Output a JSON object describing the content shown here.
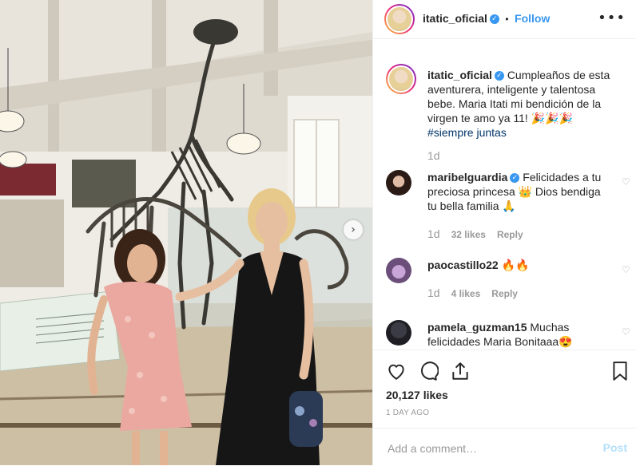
{
  "post": {
    "username": "itatic_oficial",
    "separator": "•",
    "follow_label": "Follow",
    "more_label": "•••",
    "next_label": "›",
    "caption": {
      "username": "itatic_oficial",
      "text": "Cumpleaños de esta aventurera, inteligente y talentosa bebe. Maria Itati mi bendición de la virgen te amo ya 11! 🎉🎉🎉",
      "hashtag": "#siempre juntas",
      "time": "1d"
    },
    "comments": [
      {
        "username": "maribelguardia",
        "verified": true,
        "text": "Felicidades a tu preciosa princesa 👑 Dios bendiga tu bella familia 🙏",
        "time": "1d",
        "likes": "32 likes",
        "reply": "Reply"
      },
      {
        "username": "paocastillo22",
        "verified": false,
        "text": "🔥🔥",
        "time": "1d",
        "likes": "4 likes",
        "reply": "Reply"
      },
      {
        "username": "pamela_guzman15",
        "verified": false,
        "text": "Muchas felicidades Maria Bonitaaa😍",
        "time": "",
        "likes": "",
        "reply": ""
      }
    ],
    "likes_count": "20,127 likes",
    "timestamp": "1 DAY AGO",
    "comment_placeholder": "Add a comment…",
    "post_label": "Post"
  },
  "icons": {
    "verified": "verified-badge-icon",
    "heart": "heart-icon",
    "comment": "comment-icon",
    "share": "share-icon",
    "bookmark": "bookmark-icon",
    "more": "more-options-icon"
  },
  "colors": {
    "link_blue": "#3897f0",
    "hashtag": "#003569",
    "muted": "#999999",
    "post_disabled": "#b2dffc"
  }
}
